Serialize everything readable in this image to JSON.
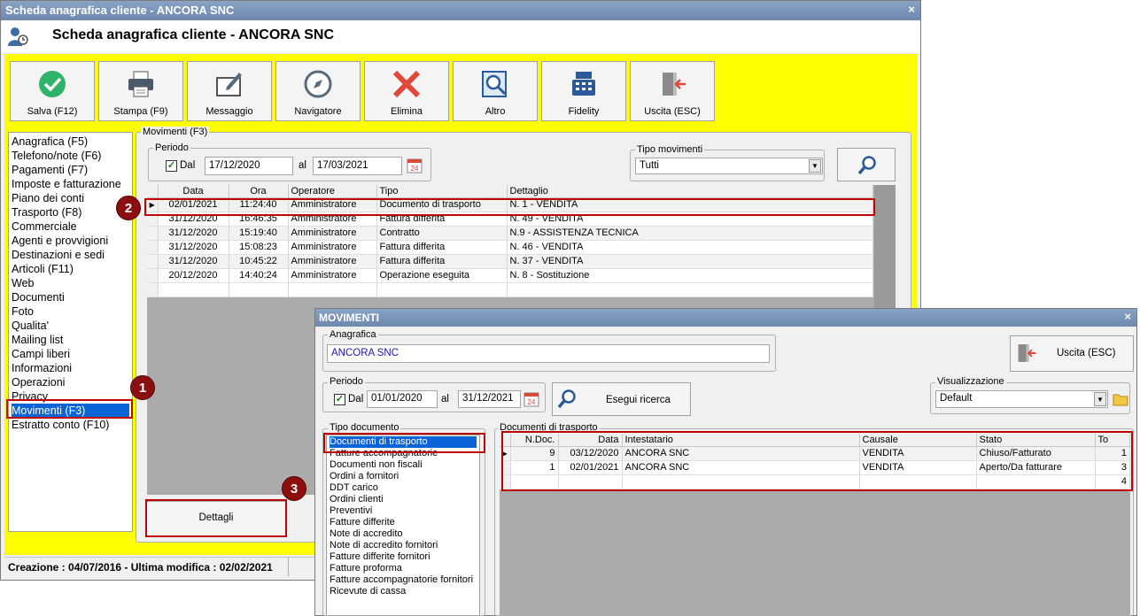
{
  "main_window": {
    "title": "Scheda anagrafica cliente - ANCORA SNC",
    "close": "×",
    "header_title": "Scheda anagrafica cliente - ANCORA SNC"
  },
  "toolbar": {
    "save": "Salva (F12)",
    "print": "Stampa (F9)",
    "message": "Messaggio",
    "navigator": "Navigatore",
    "delete": "Elimina",
    "other": "Altro",
    "fidelity": "Fidelity",
    "exit": "Uscita (ESC)"
  },
  "nav": {
    "items": [
      "Anagrafica (F5)",
      "Telefono/note (F6)",
      "Pagamenti (F7)",
      "Imposte e fatturazione",
      "Piano dei conti",
      "Trasporto (F8)",
      "Commerciale",
      "Agenti e provvigioni",
      "Destinazioni e sedi",
      "Articoli (F11)",
      "Web",
      "Documenti",
      "Foto",
      "Qualita'",
      "Mailing list",
      "Campi liberi",
      "Informazioni",
      "Operazioni",
      "Privacy",
      "Movimenti (F3)",
      "Estratto conto (F10)"
    ],
    "selected": "Movimenti (F3)"
  },
  "movimenti": {
    "group_label": "Movimenti (F3)",
    "period_label": "Periodo",
    "dal_label": "Dal",
    "al_label": "al",
    "date_from": "17/12/2020",
    "date_to": "17/03/2021",
    "tipo_label": "Tipo movimenti",
    "tipo_value": "Tutti",
    "columns": [
      "Data",
      "Ora",
      "Operatore",
      "Tipo",
      "Dettaglio"
    ],
    "rows": [
      [
        "02/01/2021",
        "11:24:40",
        "Amministratore",
        "Documento di trasporto",
        "N. 1 - VENDITA"
      ],
      [
        "31/12/2020",
        "16:46:35",
        "Amministratore",
        "Fattura differita",
        "N. 49 - VENDITA"
      ],
      [
        "31/12/2020",
        "15:19:40",
        "Amministratore",
        "Contratto",
        "N.9 - ASSISTENZA TECNICA"
      ],
      [
        "31/12/2020",
        "15:08:23",
        "Amministratore",
        "Fattura differita",
        "N. 46 - VENDITA"
      ],
      [
        "31/12/2020",
        "10:45:22",
        "Amministratore",
        "Fattura differita",
        "N. 37 - VENDITA"
      ],
      [
        "20/12/2020",
        "14:40:24",
        "Amministratore",
        "Operazione eseguita",
        "N. 8 - Sostituzione"
      ]
    ],
    "details_button": "Dettagli"
  },
  "status": {
    "text": "Creazione : 04/07/2016 - Ultima modifica : 02/02/2021"
  },
  "dialog": {
    "title": "MOVIMENTI",
    "close": "×",
    "anagrafica_label": "Anagrafica",
    "anagrafica_value": "ANCORA SNC",
    "exit_button": "Uscita (ESC)",
    "period_label": "Periodo",
    "dal_label": "Dal",
    "al_label": "al",
    "date_from": "01/01/2020",
    "date_to": "31/12/2021",
    "search_button": "Esegui ricerca",
    "view_label": "Visualizzazione",
    "view_value": "Default",
    "tipo_doc_label": "Tipo documento",
    "doc_types": [
      "Documenti di trasporto",
      "Fatture accompagnatorie",
      "Documenti non fiscali",
      "Ordini a fornitori",
      "DDT carico",
      "Ordini clienti",
      "Preventivi",
      "Fatture differite",
      "Note di accredito",
      "Note di accredito fornitori",
      "Fatture differite fornitori",
      "Fatture proforma",
      "Fatture accompagnatorie fornitori",
      "Ricevute di cassa"
    ],
    "doc_selected": "Documenti di trasporto",
    "docs_group_label": "Documenti di trasporto",
    "doc_columns": [
      "N.Doc.",
      "Data",
      "Intestatario",
      "Causale",
      "Stato",
      "To"
    ],
    "doc_rows": [
      [
        "9",
        "03/12/2020",
        "ANCORA SNC",
        "VENDITA",
        "Chiuso/Fatturato",
        "1"
      ],
      [
        "1",
        "02/01/2021",
        "ANCORA SNC",
        "VENDITA",
        "Aperto/Da fatturare",
        "3"
      ],
      [
        "",
        "",
        "",
        "",
        "",
        "4"
      ]
    ]
  },
  "markers": [
    "1",
    "2",
    "3"
  ],
  "colors": {
    "highlight": "#ffff00",
    "selection": "#0a64d8",
    "callout": "#c00000"
  }
}
